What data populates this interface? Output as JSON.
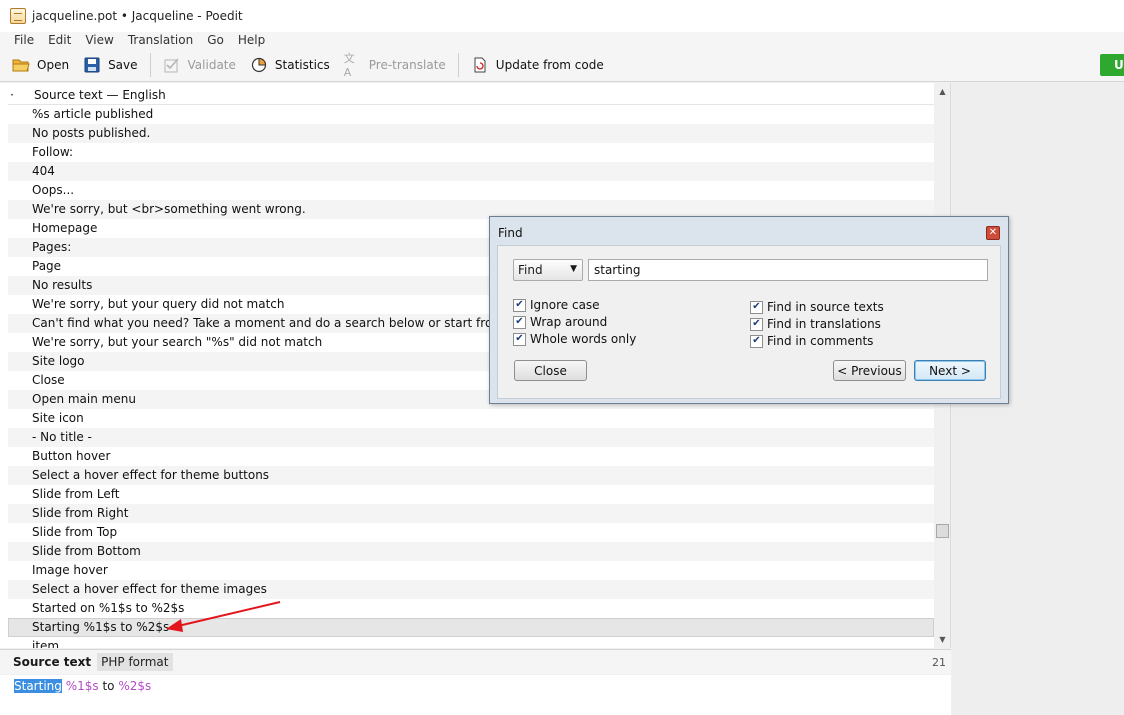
{
  "window": {
    "title": "jacqueline.pot • Jacqueline - Poedit"
  },
  "menu": [
    "File",
    "Edit",
    "View",
    "Translation",
    "Go",
    "Help"
  ],
  "toolbar": {
    "open": "Open",
    "save": "Save",
    "validate": "Validate",
    "statistics": "Statistics",
    "pretranslate": "Pre-translate",
    "update": "Update from code",
    "right_button": "U"
  },
  "list": {
    "header_dot": "·",
    "header": "Source text — English",
    "rows": [
      "%s article published",
      "No posts published.",
      "Follow:",
      "404",
      "Oops...",
      "We're sorry, but <br>something went wrong.",
      "Homepage",
      "Pages:",
      "Page",
      "No results",
      "We're sorry, but your query did not match",
      "Can't find what you need? Take a moment and do a search below or start from <a href=",
      "We're sorry, but your search \"%s\" did not match",
      "Site logo",
      "Close",
      "Open main menu",
      "Site icon",
      "- No title -",
      "Button hover",
      "Select a hover effect for theme buttons",
      "Slide from Left",
      "Slide from Right",
      "Slide from Top",
      "Slide from Bottom",
      "Image hover",
      "Select a hover effect for theme images",
      "Started on %1$s to %2$s",
      "Starting %1$s to %2$s",
      "item"
    ],
    "selected_index": 27
  },
  "editor": {
    "label": "Source text",
    "tag": "PHP format",
    "count": "21",
    "source_highlight": "Starting",
    "source_ph1": "%1$s",
    "source_mid": " to ",
    "source_ph2": "%2$s"
  },
  "find": {
    "title": "Find",
    "close_glyph": "✕",
    "mode": "Find",
    "query": "starting",
    "options_left": [
      {
        "label": "Ignore case",
        "checked": true
      },
      {
        "label": "Wrap around",
        "checked": true
      },
      {
        "label": "Whole words only",
        "checked": true
      }
    ],
    "options_right": [
      {
        "label": "Find in source texts",
        "checked": true
      },
      {
        "label": "Find in translations",
        "checked": true
      },
      {
        "label": "Find in comments",
        "checked": true
      }
    ],
    "close_button": "Close",
    "previous_button": "< Previous",
    "next_button": "Next >"
  },
  "colors": {
    "accent_green": "#2fa82f",
    "selection_blue": "#3c8fe0",
    "placeholder_purple": "#b44dc8",
    "arrow_red": "#e3151d"
  }
}
